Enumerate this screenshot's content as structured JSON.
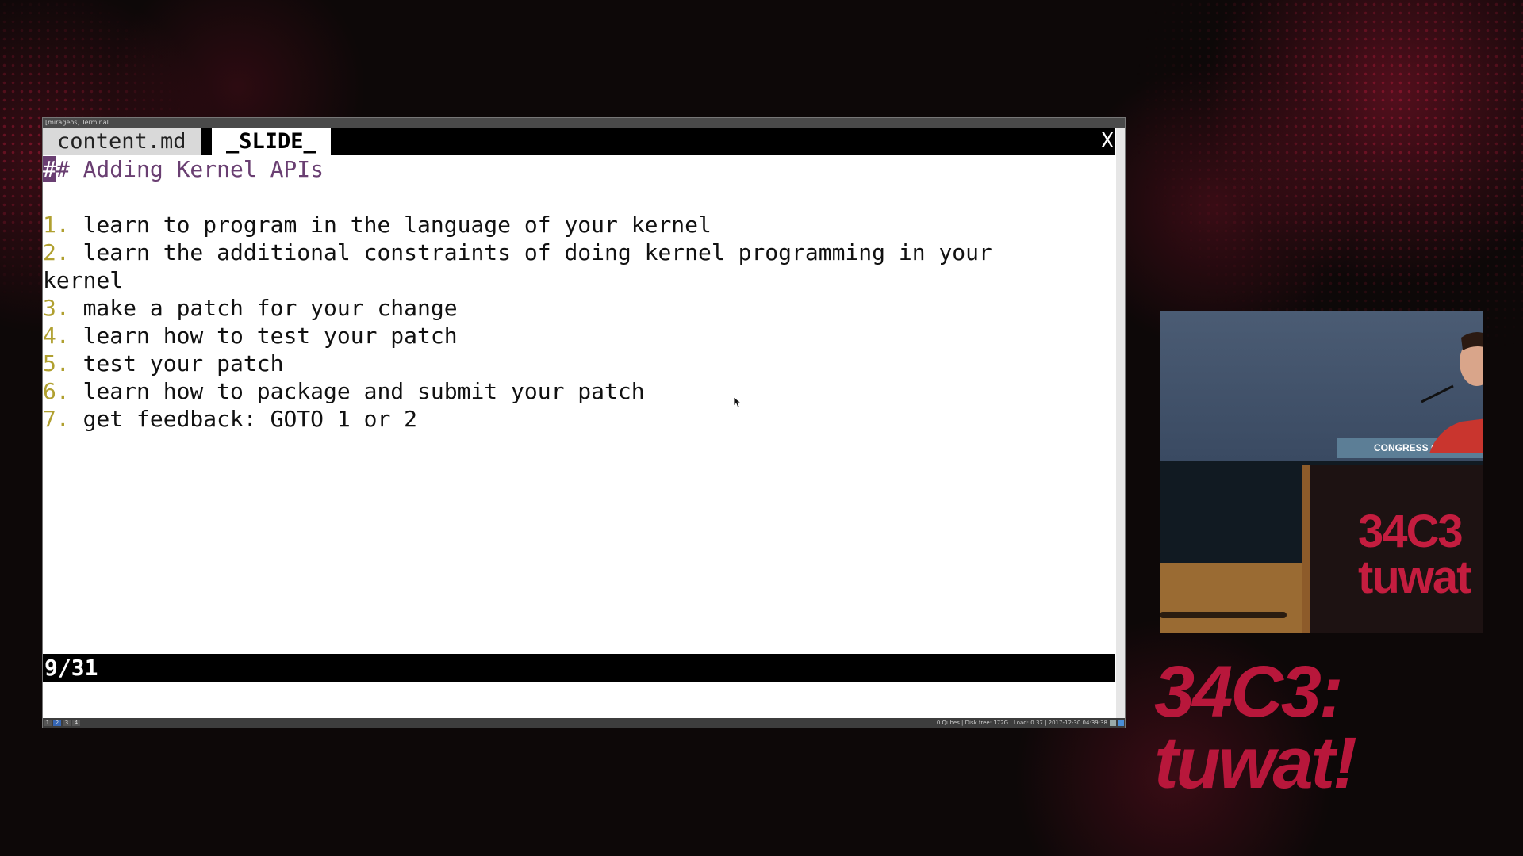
{
  "window": {
    "title": "[mirageos] Terminal"
  },
  "tabs": [
    {
      "label": "content.md",
      "active": false
    },
    {
      "label": "_SLIDE_",
      "active": true
    }
  ],
  "close_label": "X",
  "editor": {
    "heading_cursor": "#",
    "heading_rest": "# Adding Kernel APIs",
    "items": [
      {
        "num": "1.",
        "text": " learn to program in the language of your kernel"
      },
      {
        "num": "2.",
        "text": " learn the additional constraints of doing kernel programming in your"
      },
      {
        "num": "",
        "text": "kernel"
      },
      {
        "num": "3.",
        "text": " make a patch for your change"
      },
      {
        "num": "4.",
        "text": " learn how to test your patch"
      },
      {
        "num": "5.",
        "text": " test your patch"
      },
      {
        "num": "6.",
        "text": " learn how to package and submit your patch"
      },
      {
        "num": "7.",
        "text": " get feedback: GOTO 1 or 2"
      }
    ]
  },
  "status": {
    "page": "9/31"
  },
  "desktop_bar": {
    "workspaces": [
      "1",
      "2",
      "3",
      "4"
    ],
    "system_status": "0 Qubes | Disk free: 172G | Load: 0.37 | 2017-12-30 04:39:38"
  },
  "video": {
    "sign_text": "CONGRESS CENTER LE",
    "lectern_logo": [
      "34C3",
      "tuwat"
    ]
  },
  "event_logo": {
    "line1": "34C3:",
    "line2": "tuwat!"
  },
  "colors": {
    "heading": "#6a3f72",
    "list_number": "#b0a030",
    "brand_red": "#b8173b"
  }
}
